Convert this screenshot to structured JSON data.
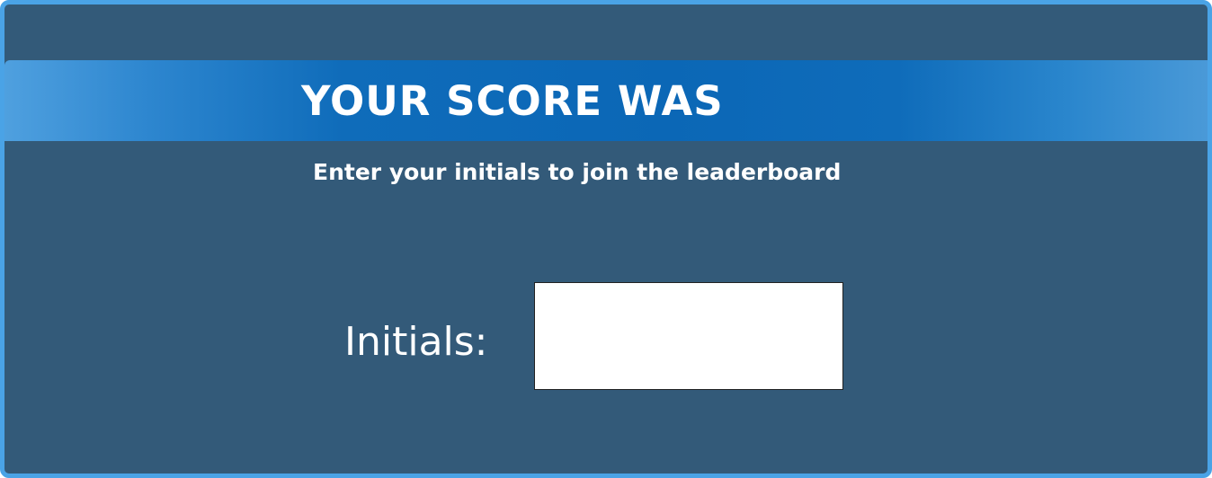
{
  "banner": {
    "title": "YOUR SCORE WAS"
  },
  "prompt": {
    "text": "Enter your initials to join the leaderboard"
  },
  "initials": {
    "label": "Initials:",
    "value": "",
    "placeholder": ""
  },
  "colors": {
    "panel_background": "#335a79",
    "panel_border": "#4aa3e6",
    "banner_center": "#0b67b6",
    "banner_edges": "#4fa0df",
    "text": "#ffffff",
    "input_background": "#ffffff"
  }
}
